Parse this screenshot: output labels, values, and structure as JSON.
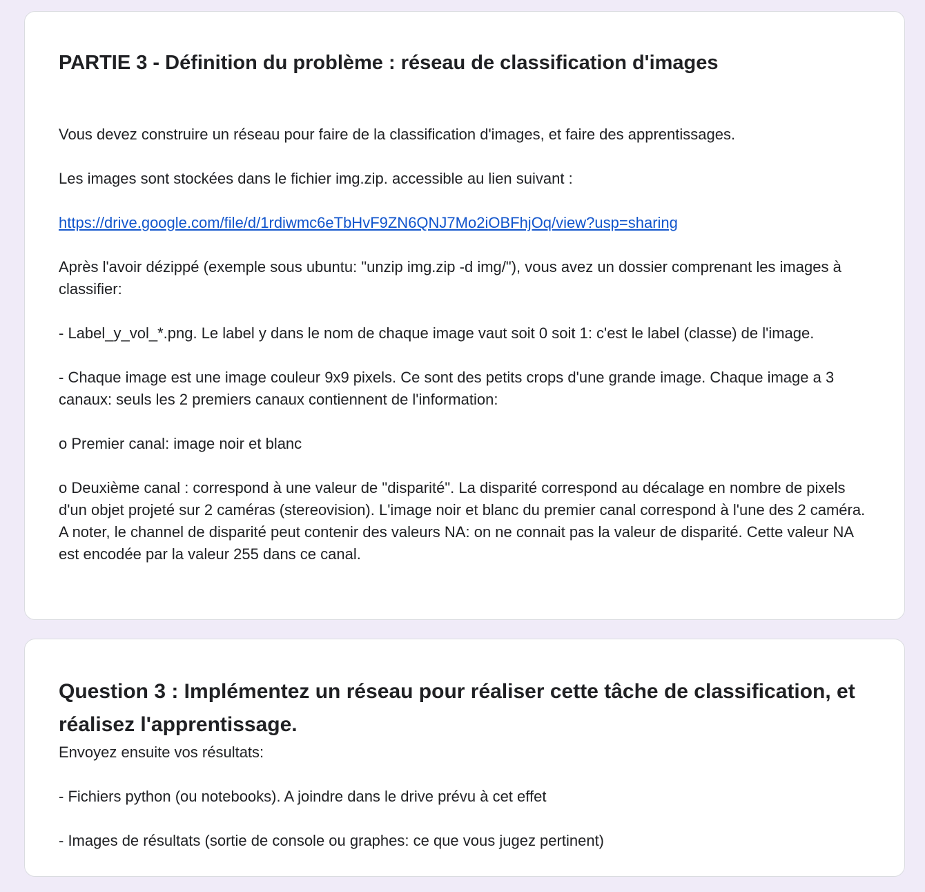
{
  "section": {
    "title": "PARTIE 3 - Définition du problème : réseau de classification d'images",
    "paragraphs": [
      "Vous devez construire un réseau pour faire de la classification d'images, et faire des apprentissages.",
      "Les images sont stockées dans le fichier img.zip. accessible au lien suivant :"
    ],
    "link": "https://drive.google.com/file/d/1rdiwmc6eTbHvF9ZN6QNJ7Mo2iOBFhjOq/view?usp=sharing",
    "paragraphs_after": [
      "Après l'avoir dézippé (exemple sous ubuntu: \"unzip img.zip -d img/\"), vous avez un dossier comprenant les images à classifier:",
      "- Label_y_vol_*.png. Le label y dans le nom de chaque image vaut soit 0 soit 1: c'est le label (classe) de l'image.",
      "- Chaque image est une image couleur 9x9 pixels. Ce sont des petits crops d'une grande image. Chaque image a 3 canaux: seuls les 2 premiers canaux contiennent de l'information:",
      "o Premier canal: image noir et blanc",
      "o Deuxième canal : correspond à une valeur de \"disparité\". La disparité correspond au décalage en nombre de pixels d'un objet projeté sur 2 caméras (stereovision). L'image noir et blanc du premier canal correspond à l'une des 2 caméra. A noter, le channel de disparité peut contenir des valeurs NA: on ne connait pas la valeur de disparité. Cette valeur NA est encodée par la valeur 255 dans ce canal."
    ]
  },
  "question": {
    "title": "Question 3 : Implémentez un réseau pour réaliser cette tâche de classification, et réalisez l'apprentissage.",
    "paragraphs": [
      "Envoyez ensuite vos résultats:",
      "- Fichiers python (ou notebooks). A joindre dans le drive prévu à cet effet",
      "- Images de résultats (sortie de console ou graphes: ce que vous jugez pertinent)"
    ]
  }
}
